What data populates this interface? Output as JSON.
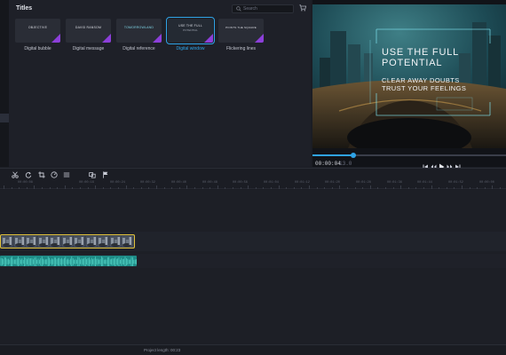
{
  "titles_panel": {
    "heading": "Titles",
    "search": {
      "placeholder": "Search"
    },
    "cards": [
      {
        "label": "Digital bubble",
        "thumb_line1": "OBJECTIVE",
        "thumb_line2": "",
        "selected": false
      },
      {
        "label": "Digital message",
        "thumb_line1": "DAVID RANSOM",
        "thumb_line2": "",
        "selected": false
      },
      {
        "label": "Digital reference",
        "thumb_line1": "TOMORROWLAND",
        "thumb_line2": "",
        "selected": false
      },
      {
        "label": "Digital window",
        "thumb_line1": "USE THE FULL",
        "thumb_line2": "POTENTIAL",
        "selected": true
      },
      {
        "label": "Flickering lines",
        "thumb_line1": "POINTS THE SQUARE",
        "thumb_line2": "",
        "selected": false
      }
    ]
  },
  "preview": {
    "overlay": {
      "line1": "USE THE FULL",
      "line2": "POTENTIAL",
      "line3": "CLEAR AWAY DOUBTS",
      "line4": "TRUST YOUR FEELINGS"
    },
    "time_current": "00:00:04",
    "time_rest": "13.0",
    "progress": 0.21
  },
  "toolbar": {
    "icons": [
      "scissors-icon",
      "redo-icon",
      "crop-icon",
      "speed-icon",
      "list-icon",
      "split-icon",
      "flag-icon"
    ]
  },
  "timeline": {
    "ruler_labels": [
      "00:00:00",
      "00:00:08",
      "00:00:16",
      "00:00:24",
      "00:00:32",
      "00:00:40",
      "00:00:48",
      "00:00:56",
      "00:01:04",
      "00:01:12",
      "00:01:20",
      "00:01:28",
      "00:01:36",
      "00:01:44",
      "00:01:52"
    ]
  },
  "status": {
    "project_length": "Project length: 00:23"
  },
  "colors": {
    "accent": "#2fa3e6",
    "clip_border": "#e2c33c",
    "audio": "#1e8b86",
    "premium": "#8c3fd9"
  }
}
